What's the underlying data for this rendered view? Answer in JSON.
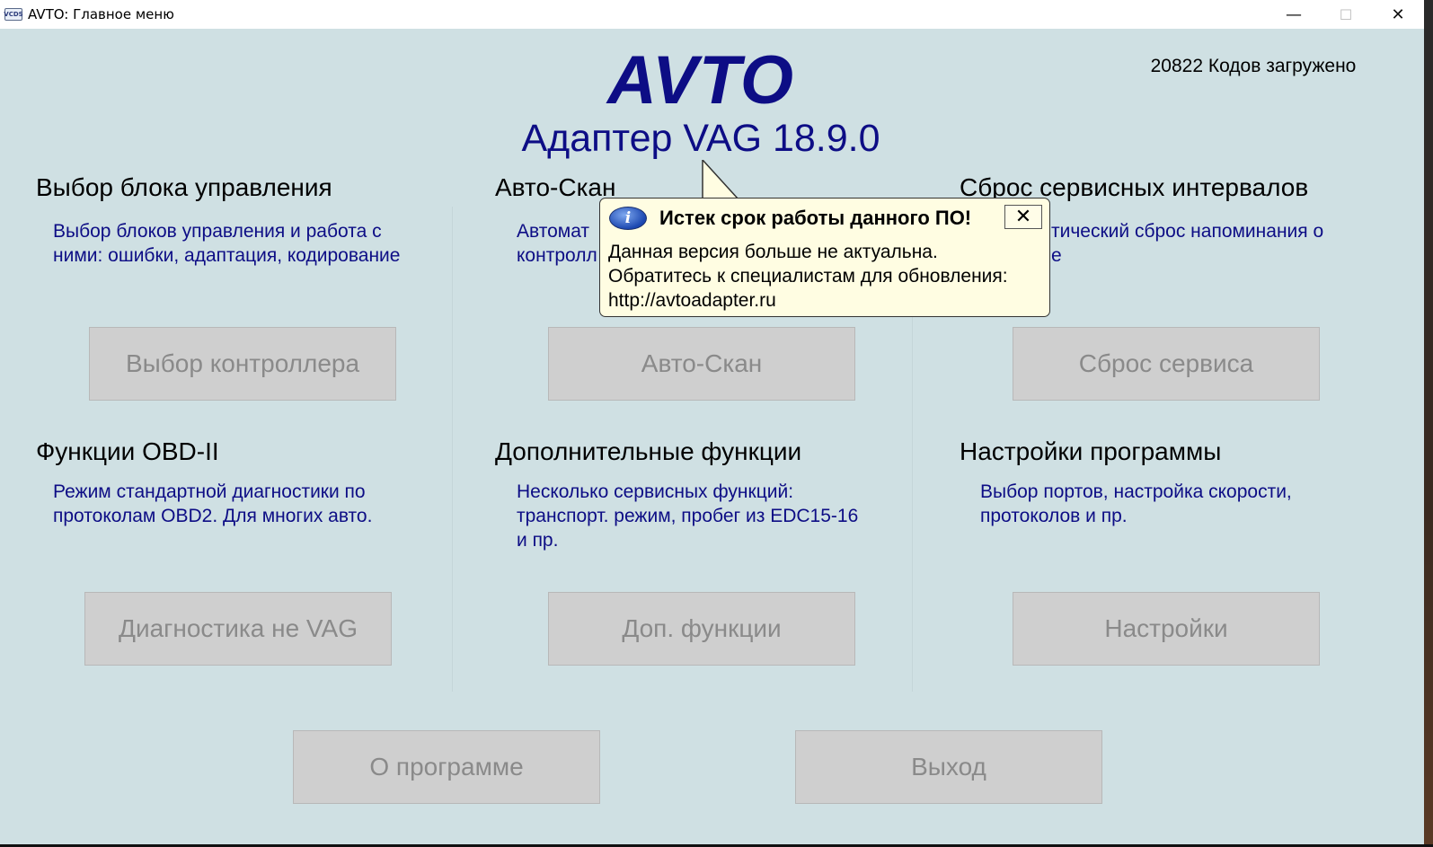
{
  "window": {
    "icon_label": "VCDS",
    "title": "AVTO:  Главное меню",
    "controls": {
      "minimize": "—",
      "maximize": "☐",
      "close": "✕"
    }
  },
  "header": {
    "logo": "AVTO",
    "subtitle": "Адаптер VAG 18.9.0",
    "codes_loaded": "20822 Кодов загружено"
  },
  "sections": [
    {
      "title": "Выбор блока управления",
      "desc_lines": [
        "Выбор блоков управления и работа с",
        "ними: ошибки, адаптация, кодирование"
      ],
      "button": "Выбор контроллера"
    },
    {
      "title": "Авто-Скан",
      "desc_lines": [
        "Автомат",
        "контролл"
      ],
      "button": "Авто-Скан"
    },
    {
      "title": "Сброс сервисных интервалов",
      "desc_lines": [
        "тический сброс напоминания о",
        "е"
      ],
      "button": "Сброс сервиса"
    },
    {
      "title": "Функции OBD-II",
      "desc_lines": [
        "Режим стандартной диагностики по",
        "протоколам OBD2. Для многих авто."
      ],
      "button": "Диагностика не VAG"
    },
    {
      "title": "Дополнительные функции",
      "desc_lines": [
        "Несколько сервисных функций:",
        "транспорт. режим, пробег из EDC15-16",
        "и пр."
      ],
      "button": "Доп. функции"
    },
    {
      "title": "Настройки программы",
      "desc_lines": [
        "Выбор портов, настройка скорости,",
        "протоколов и пр."
      ],
      "button": "Настройки"
    }
  ],
  "bottom_buttons": {
    "about": "О программе",
    "exit": "Выход"
  },
  "tooltip": {
    "icon": "info-icon",
    "icon_glyph": "i",
    "title": "Истек срок работы данного ПО!",
    "close": "✕",
    "lines": [
      "Данная версия больше не актуальна.",
      "Обратитесь к специалистам для обновления:",
      "http://avtoadapter.ru"
    ]
  }
}
